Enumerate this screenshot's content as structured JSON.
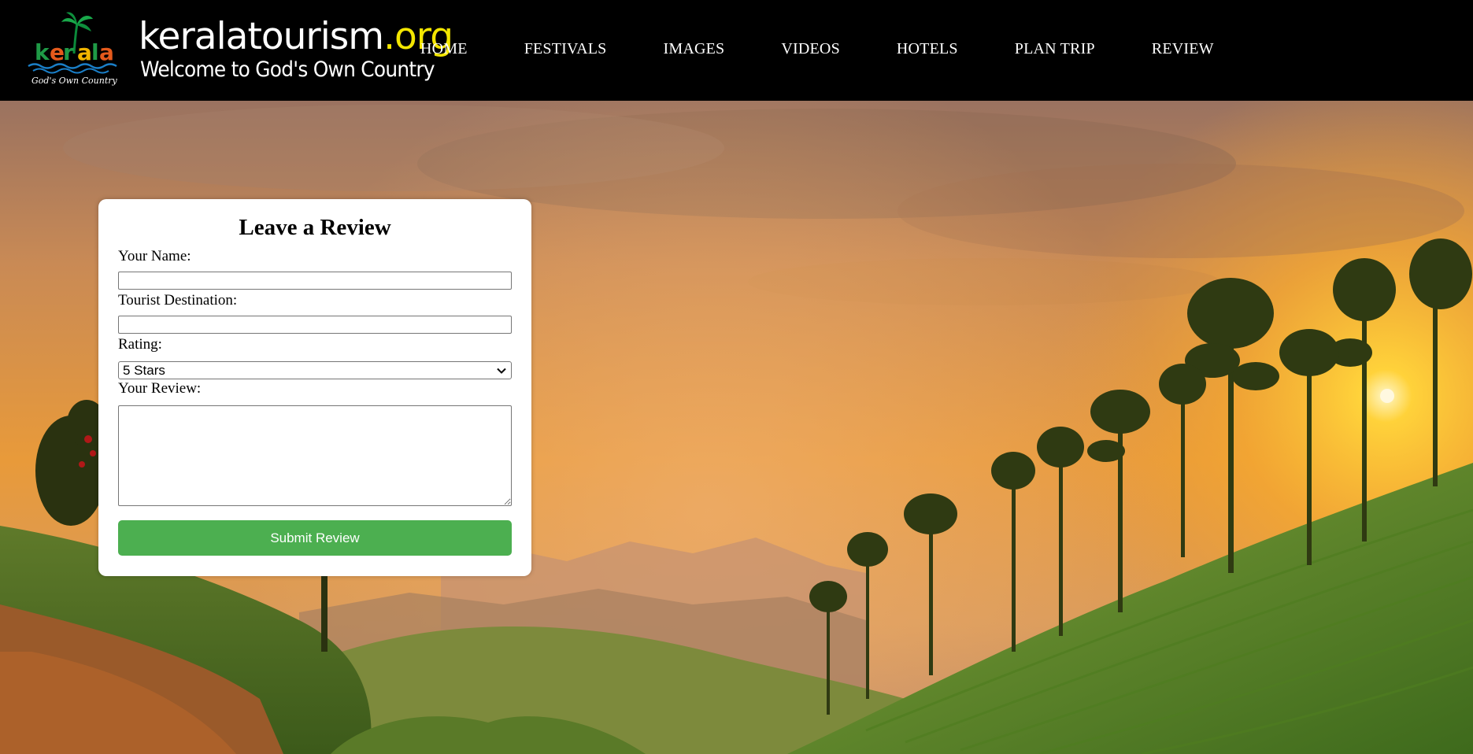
{
  "header": {
    "logo_alt": "kerala",
    "logo_tagline": "God's Own Country",
    "site_name": "keralatourism",
    "site_tld": ".org",
    "tagline": "Welcome to God's Own Country"
  },
  "nav": {
    "items": [
      {
        "label": "HOME"
      },
      {
        "label": "FESTIVALS"
      },
      {
        "label": "IMAGES"
      },
      {
        "label": "VIDEOS"
      },
      {
        "label": "HOTELS"
      },
      {
        "label": "PLAN TRIP"
      },
      {
        "label": "REVIEW"
      }
    ]
  },
  "review_form": {
    "title": "Leave a Review",
    "name_label": "Your Name:",
    "name_value": "",
    "destination_label": "Tourist Destination:",
    "destination_value": "",
    "rating_label": "Rating:",
    "rating_selected": "5 Stars",
    "review_label": "Your Review:",
    "review_value": "",
    "submit_label": "Submit Review"
  },
  "colors": {
    "header_bg": "#000000",
    "submit_button": "#4caf50",
    "tld_accent": "#f3e600"
  },
  "icons": {
    "logo": "kerala-palm-logo",
    "select": "chevron-down-icon"
  }
}
